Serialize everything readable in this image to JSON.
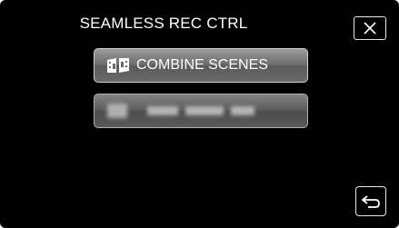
{
  "screen": {
    "title": "SEAMLESS REC CTRL"
  },
  "menu": {
    "combine_label": "COMBINE SCENES",
    "combine_icon": "combine-scenes-icon",
    "second_item_state": "disabled (blurred)"
  },
  "controls": {
    "close_icon": "close-icon",
    "back_icon": "return-arrow-icon"
  },
  "colors": {
    "background": "#000000",
    "button_gradient_top": "#9a9a9a",
    "button_gradient_bottom": "#5a5a5a",
    "text": "#ffffff"
  }
}
